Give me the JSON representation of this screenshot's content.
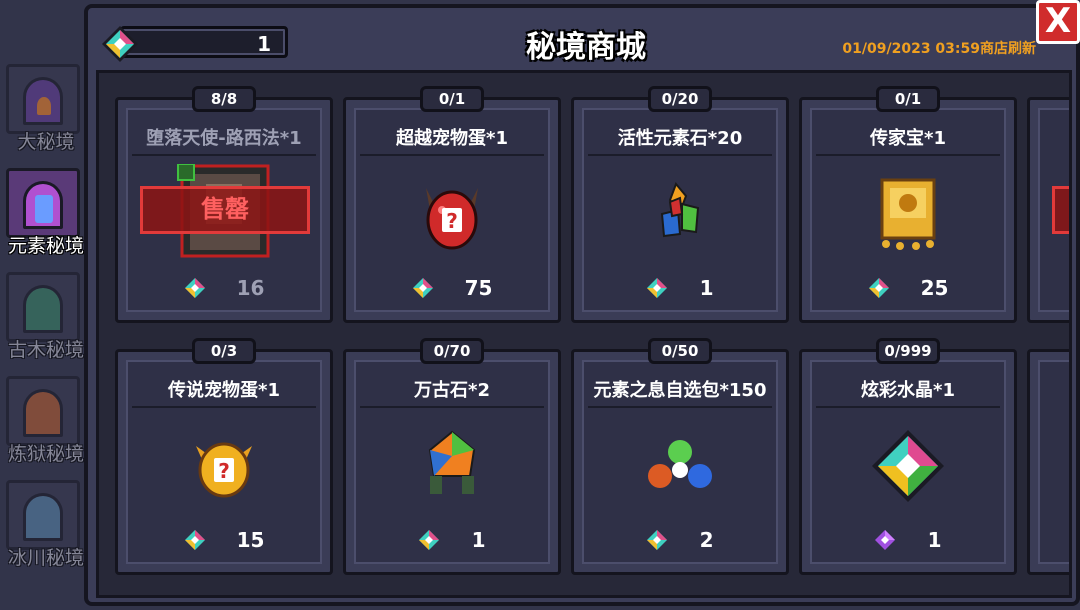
{
  "shop": {
    "title": "秘境商城",
    "currency_value": "1",
    "refresh_text": "01/09/2023 03:59商店刷新",
    "close_label": "X"
  },
  "sidebar": {
    "items": [
      {
        "label": "大秘境",
        "icon": "dungeon-door-icon",
        "color": "#6a3fa0"
      },
      {
        "label": "元素秘境",
        "icon": "element-portal-icon",
        "color": "#b050d0"
      },
      {
        "label": "古木秘境",
        "icon": "ancient-wood-portal-icon",
        "color": "#3a8a6a"
      },
      {
        "label": "炼狱秘境",
        "icon": "inferno-portal-icon",
        "color": "#c06030"
      },
      {
        "label": "冰川秘境",
        "icon": "glacier-portal-icon",
        "color": "#5a8ab0"
      }
    ]
  },
  "items": [
    {
      "stock": "8/8",
      "name": "堕落天使-路西法*1",
      "price": "16",
      "icon": "lucifer-portrait-icon",
      "sold_out": true,
      "sold_label": "售罄"
    },
    {
      "stock": "0/1",
      "name": "超越宠物蛋*1",
      "price": "75",
      "icon": "transcend-pet-egg-icon"
    },
    {
      "stock": "0/20",
      "name": "活性元素石*20",
      "price": "1",
      "icon": "element-stones-icon"
    },
    {
      "stock": "0/1",
      "name": "传家宝*1",
      "price": "25",
      "icon": "heirloom-icon"
    },
    {
      "stock": "0/3",
      "name": "传说宠物蛋*1",
      "price": "15",
      "icon": "legend-pet-egg-icon"
    },
    {
      "stock": "0/70",
      "name": "万古石*2",
      "price": "1",
      "icon": "eternal-stone-icon"
    },
    {
      "stock": "0/50",
      "name": "元素之息自选包*150",
      "price": "2",
      "icon": "element-breath-pack-icon"
    },
    {
      "stock": "0/999",
      "name": "炫彩水晶*1",
      "price": "1",
      "icon": "dazzle-crystal-icon"
    }
  ]
}
